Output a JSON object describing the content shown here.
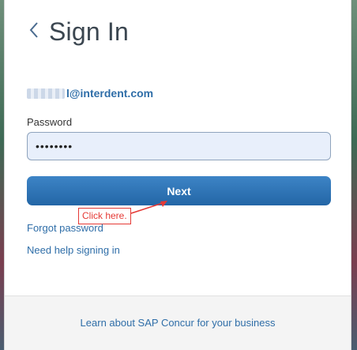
{
  "header": {
    "title": "Sign In"
  },
  "account": {
    "email_visible": "l@interdent.com"
  },
  "password": {
    "label": "Password",
    "value": "••••••••"
  },
  "actions": {
    "next_label": "Next"
  },
  "annotation": {
    "text": "Click here."
  },
  "links": {
    "forgot": "Forgot password",
    "help": "Need help signing in"
  },
  "footer": {
    "link": "Learn about SAP Concur for your business"
  },
  "colors": {
    "primary": "#2366a6",
    "link": "#2f6ea8",
    "annotation": "#e53935",
    "field_bg": "#e8effb"
  },
  "icons": {
    "back": "chevron-left-icon"
  }
}
